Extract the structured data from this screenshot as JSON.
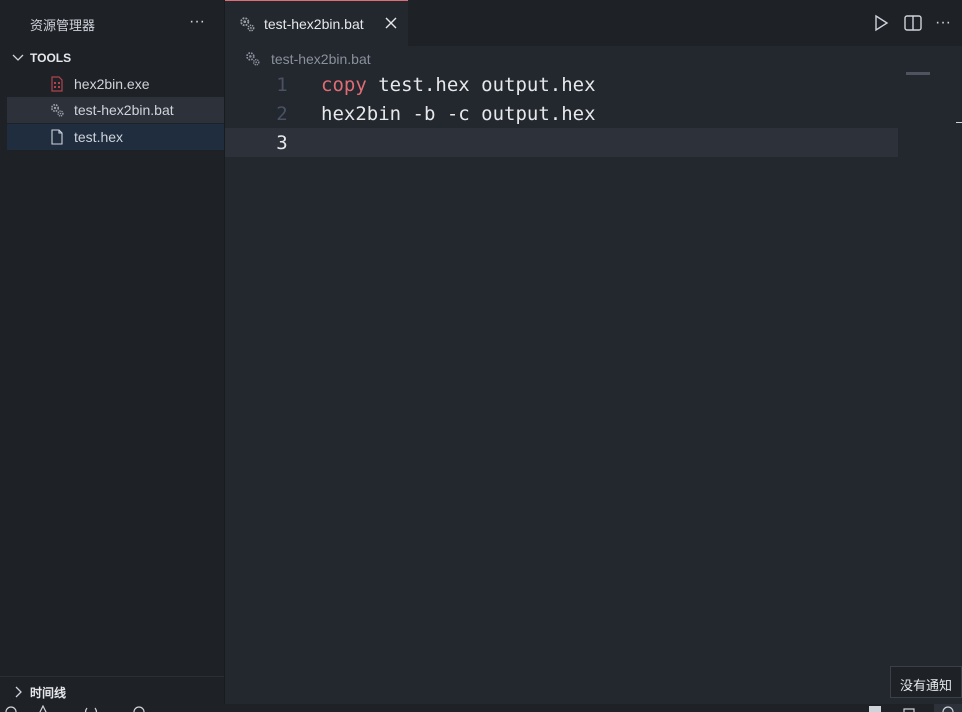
{
  "sidebar": {
    "title": "资源管理器",
    "more_label": "···",
    "section": "TOOLS",
    "files": [
      {
        "name": "hex2bin.exe",
        "icon": "exe-file-icon"
      },
      {
        "name": "test-hex2bin.bat",
        "icon": "gear-file-icon"
      },
      {
        "name": "test.hex",
        "icon": "file-icon"
      }
    ],
    "timeline": "时间线"
  },
  "tab": {
    "label": "test-hex2bin.bat",
    "accent": "#e06c75"
  },
  "breadcrumb": {
    "label": "test-hex2bin.bat"
  },
  "editor": {
    "lines": [
      {
        "num": "1",
        "keyword": "copy",
        "rest": " test.hex output.hex"
      },
      {
        "num": "2",
        "keyword": "",
        "rest": "hex2bin -b -c output.hex"
      },
      {
        "num": "3",
        "keyword": "",
        "rest": ""
      }
    ],
    "keyword_color": "#e06c75"
  },
  "notification": {
    "text": "没有通知"
  },
  "tab_actions": [
    "run-icon",
    "split-editor-icon",
    "more-icon"
  ],
  "more_label": "···"
}
